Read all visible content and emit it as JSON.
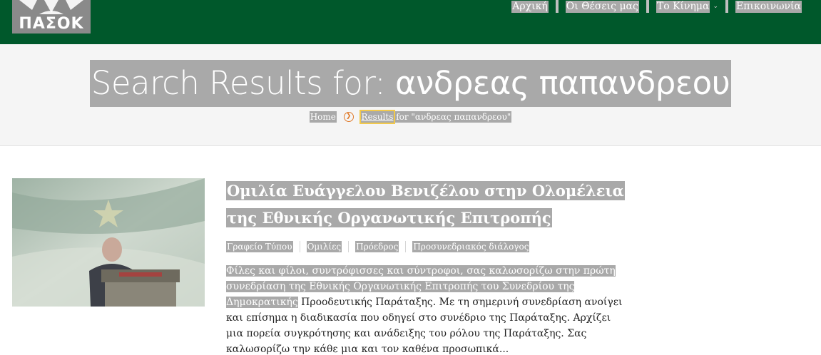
{
  "header": {
    "logo_text": "ΠΑΣΟΚ",
    "nav": [
      {
        "label": "Αρχική"
      },
      {
        "label": "Οι Θέσεις μας"
      },
      {
        "label": "Το Κίνημα",
        "has_dropdown": true
      },
      {
        "label": "Επικοινωνία"
      }
    ]
  },
  "page": {
    "title_prefix": "Search Results for: ",
    "title_query": "ανδρεας παπανδρεου"
  },
  "breadcrumb": {
    "home": "Home",
    "current_link": "Results",
    "current_rest": " for \"ανδρεας παπανδρεου\""
  },
  "result": {
    "title": "Ομιλία Ευάγγελου Βενιζέλου στην Ολομέλεια της Εθνικής Οργανωτικής Επιτροπής",
    "categories": [
      "Γραφείο Τύπου",
      "Ομιλίες",
      "Πρόεδρος",
      "Προσυνεδριακός διάλογος"
    ],
    "excerpt_highlighted": "Φίλες και φίλοι, συντρόφισσες και σύντροφοι, σας καλωσορίζω στην πρώτη συνεδρίαση της Εθνικής Οργανωτικής Επιτροπής του Συνεδρίου της Δημοκρατικής",
    "excerpt_rest": " Προοδευτικής Παράταξης. Με τη σημερινή συνεδρίαση ανοίγει και επίσημα η διαδικασία που οδηγεί στο συνέδριο της Παράταξης. Αρχίζει μια πορεία συγκρότησης και ανάδειξης του ρόλου της Παράταξης. Σας καλωσορίζω την κάθε μια και τον καθένα προσωπικά..."
  },
  "colors": {
    "header_bg": "#00582b",
    "highlight_bg": "#a9a9a9",
    "accent_orange": "#e07a2a"
  }
}
